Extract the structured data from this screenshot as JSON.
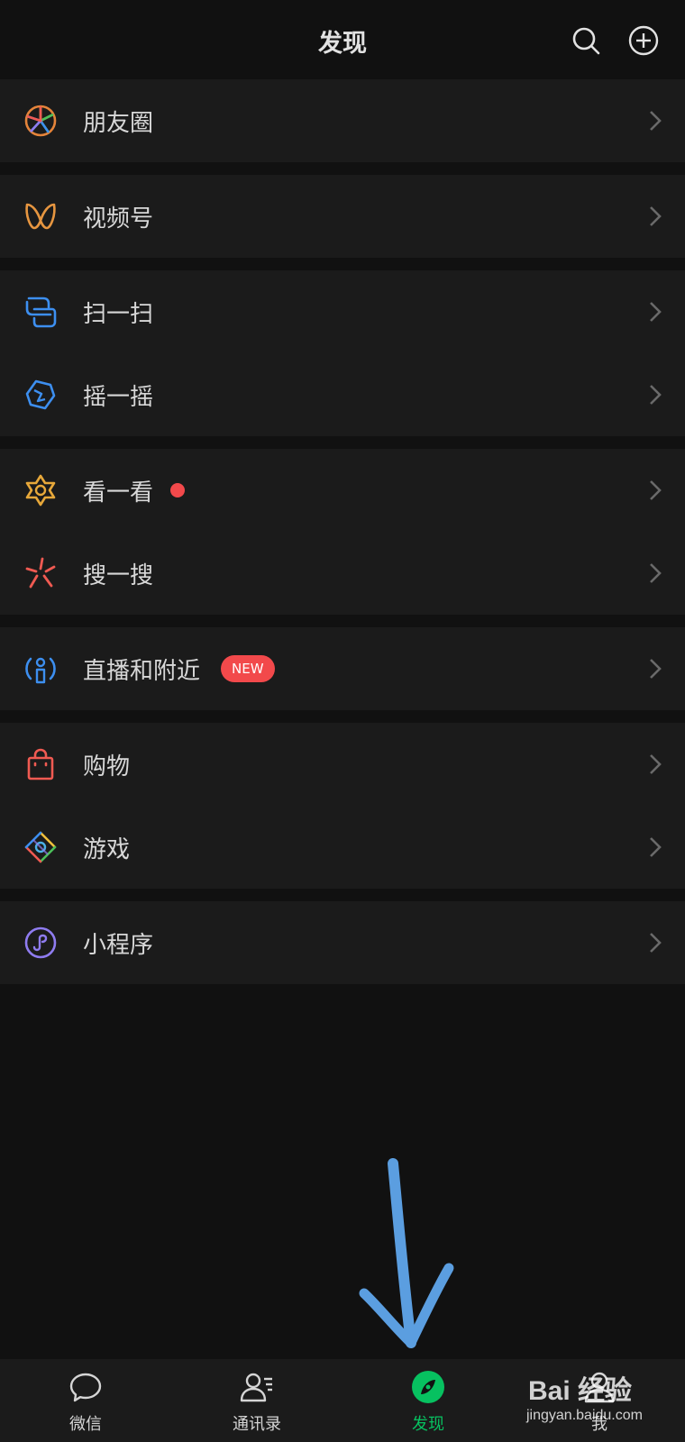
{
  "header": {
    "title": "发现",
    "search_icon": "search-icon",
    "add_icon": "plus-circle-icon"
  },
  "menu": {
    "moments": {
      "label": "朋友圈",
      "icon": "aperture-icon",
      "color": "#e5843a"
    },
    "channels": {
      "label": "视频号",
      "icon": "butterfly-icon",
      "color": "#e79640"
    },
    "scan": {
      "label": "扫一扫",
      "icon": "scan-icon",
      "color": "#3d8ff0"
    },
    "shake": {
      "label": "摇一摇",
      "icon": "shake-icon",
      "color": "#3d8ff0"
    },
    "top_stories": {
      "label": "看一看",
      "icon": "star-icon",
      "color": "#e7a83a",
      "has_red_dot": true
    },
    "search": {
      "label": "搜一搜",
      "icon": "search-spark-icon",
      "color": "#f05a52"
    },
    "live_nearby": {
      "label": "直播和附近",
      "icon": "live-person-icon",
      "color": "#3d8ff0",
      "badge": "NEW"
    },
    "shopping": {
      "label": "购物",
      "icon": "shopping-bag-icon",
      "color": "#f05a52"
    },
    "games": {
      "label": "游戏",
      "icon": "game-diamond-icon",
      "color": "#4ab0e6"
    },
    "mini_programs": {
      "label": "小程序",
      "icon": "mini-program-icon",
      "color": "#8f7cf0"
    }
  },
  "tabbar": {
    "chats": {
      "label": "微信",
      "icon": "chat-bubble-icon"
    },
    "contacts": {
      "label": "通讯录",
      "icon": "contacts-icon"
    },
    "discover": {
      "label": "发现",
      "icon": "compass-icon",
      "active": true
    },
    "me": {
      "label": "我",
      "icon": "person-icon"
    }
  },
  "accent_color": "#07c160",
  "watermark": {
    "line1": "Bai  经验",
    "line2": "jingyan.baidu.com"
  }
}
